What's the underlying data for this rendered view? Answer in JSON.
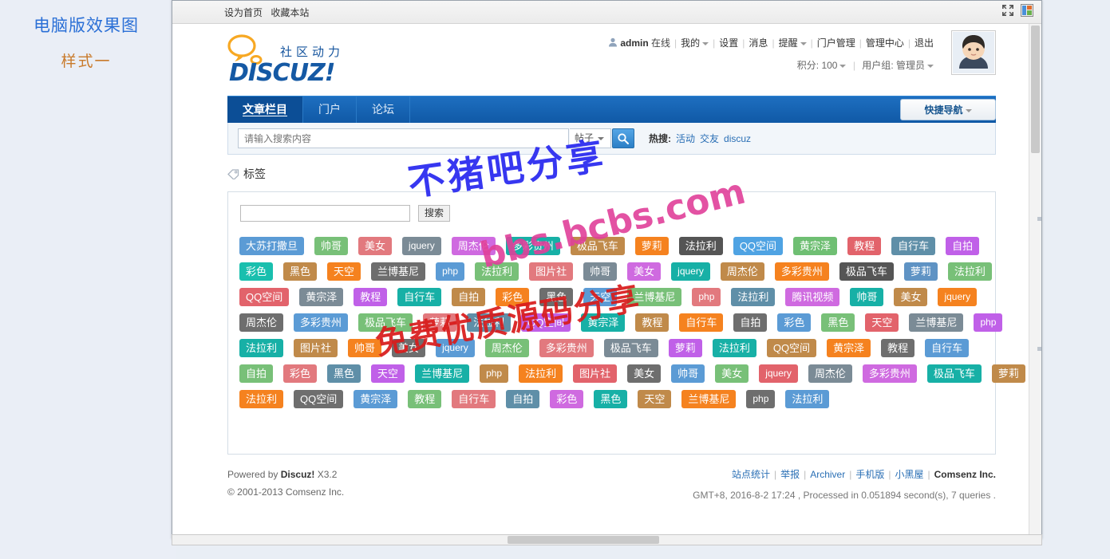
{
  "caption": {
    "line1": "电脑版效果图",
    "line2": "样式一"
  },
  "browser": {
    "topbar_links": [
      "设为首页",
      "收藏本站"
    ],
    "icons": [
      "expand-icon",
      "theme-icon"
    ]
  },
  "logo": {
    "slogan": "社区动力",
    "wordmark": "DISCUZ!"
  },
  "user": {
    "name": "admin",
    "status": "在线",
    "links": [
      "我的",
      "设置",
      "消息",
      "提醒",
      "门户管理",
      "管理中心",
      "退出"
    ],
    "credit_label": "积分",
    "credit_value": "100",
    "group_label": "用户组",
    "group_value": "管理员"
  },
  "nav": {
    "tabs": [
      {
        "label": "文章栏目",
        "active": true
      },
      {
        "label": "门户",
        "active": false
      },
      {
        "label": "论坛",
        "active": false
      }
    ],
    "quick_nav": "快捷导航"
  },
  "search": {
    "placeholder": "请输入搜索内容",
    "value": "",
    "type": "帖子",
    "button_icon": "search-icon",
    "hot_label": "热搜:",
    "hot_items": [
      "活动",
      "交友",
      "discuz"
    ]
  },
  "tag_section": {
    "title": "标签",
    "icon": "tag-icon",
    "filter_value": "",
    "search_button": "搜索",
    "rows": [
      [
        {
          "text": "大苏打撒旦",
          "color": "#5b9bd5"
        },
        {
          "text": "帅哥",
          "color": "#78c078"
        },
        {
          "text": "美女",
          "color": "#e2797e"
        },
        {
          "text": "jquery",
          "color": "#7b8b96"
        },
        {
          "text": "周杰伦",
          "color": "#cf6ae0"
        },
        {
          "text": "多彩贵州",
          "color": "#17b0a6"
        },
        {
          "text": "极品飞车",
          "color": "#c08a4a"
        },
        {
          "text": "萝莉",
          "color": "#f5821f"
        },
        {
          "text": "法拉利",
          "color": "#555555"
        },
        {
          "text": "QQ空间",
          "color": "#4fa3e3"
        },
        {
          "text": "黄宗泽",
          "color": "#6fbf73"
        },
        {
          "text": "教程",
          "color": "#e2636b"
        },
        {
          "text": "自行车",
          "color": "#5f8fa8"
        },
        {
          "text": "自拍",
          "color": "#c060e8"
        }
      ],
      [
        {
          "text": "彩色",
          "color": "#19bfae"
        },
        {
          "text": "黑色",
          "color": "#c08a4a"
        },
        {
          "text": "天空",
          "color": "#f5821f"
        },
        {
          "text": "兰博基尼",
          "color": "#6e6e6e"
        },
        {
          "text": "php",
          "color": "#5b9bd5"
        },
        {
          "text": "法拉利",
          "color": "#78c078"
        },
        {
          "text": "图片社",
          "color": "#e2797e"
        },
        {
          "text": "帅哥",
          "color": "#7b8b96"
        },
        {
          "text": "美女",
          "color": "#cf6ae0"
        },
        {
          "text": "jquery",
          "color": "#17b0a6"
        },
        {
          "text": "周杰伦",
          "color": "#c08a4a"
        },
        {
          "text": "多彩贵州",
          "color": "#f5821f"
        },
        {
          "text": "极品飞车",
          "color": "#555555"
        },
        {
          "text": "萝莉",
          "color": "#5f93c4"
        },
        {
          "text": "法拉利",
          "color": "#78c078"
        }
      ],
      [
        {
          "text": "QQ空间",
          "color": "#e2636b"
        },
        {
          "text": "黄宗泽",
          "color": "#7b8b96"
        },
        {
          "text": "教程",
          "color": "#c060e8"
        },
        {
          "text": "自行车",
          "color": "#17b0a6"
        },
        {
          "text": "自拍",
          "color": "#c08a4a"
        },
        {
          "text": "彩色",
          "color": "#f5821f"
        },
        {
          "text": "黑色",
          "color": "#6e6e6e"
        },
        {
          "text": "天空",
          "color": "#5b9bd5"
        },
        {
          "text": "兰博基尼",
          "color": "#78c078"
        },
        {
          "text": "php",
          "color": "#e2797e"
        },
        {
          "text": "法拉利",
          "color": "#5f8fa8"
        },
        {
          "text": "腾讯视频",
          "color": "#cf6ae0"
        },
        {
          "text": "帅哥",
          "color": "#17b0a6"
        },
        {
          "text": "美女",
          "color": "#c08a4a"
        },
        {
          "text": "jquery",
          "color": "#f5821f"
        }
      ],
      [
        {
          "text": "周杰伦",
          "color": "#6e6e6e"
        },
        {
          "text": "多彩贵州",
          "color": "#5b9bd5"
        },
        {
          "text": "极品飞车",
          "color": "#78c078"
        },
        {
          "text": "萝莉",
          "color": "#e2797e"
        },
        {
          "text": "法拉利",
          "color": "#5f8fa8"
        },
        {
          "text": "QQ空间",
          "color": "#c060e8"
        },
        {
          "text": "黄宗泽",
          "color": "#17b0a6"
        },
        {
          "text": "教程",
          "color": "#c08a4a"
        },
        {
          "text": "自行车",
          "color": "#f5821f"
        },
        {
          "text": "自拍",
          "color": "#6e6e6e"
        },
        {
          "text": "彩色",
          "color": "#5b9bd5"
        },
        {
          "text": "黑色",
          "color": "#78c078"
        },
        {
          "text": "天空",
          "color": "#e2636b"
        },
        {
          "text": "兰博基尼",
          "color": "#7b8b96"
        },
        {
          "text": "php",
          "color": "#c060e8"
        }
      ],
      [
        {
          "text": "法拉利",
          "color": "#17b0a6"
        },
        {
          "text": "图片社",
          "color": "#c08a4a"
        },
        {
          "text": "帅哥",
          "color": "#f5821f"
        },
        {
          "text": "美女",
          "color": "#6e6e6e"
        },
        {
          "text": "jquery",
          "color": "#5b9bd5"
        },
        {
          "text": "周杰伦",
          "color": "#78c078"
        },
        {
          "text": "多彩贵州",
          "color": "#e2797e"
        },
        {
          "text": "极品飞车",
          "color": "#7b8b96"
        },
        {
          "text": "萝莉",
          "color": "#c060e8"
        },
        {
          "text": "法拉利",
          "color": "#17b0a6"
        },
        {
          "text": "QQ空间",
          "color": "#c08a4a"
        },
        {
          "text": "黄宗泽",
          "color": "#f5821f"
        },
        {
          "text": "教程",
          "color": "#6e6e6e"
        },
        {
          "text": "自行车",
          "color": "#5b9bd5"
        }
      ],
      [
        {
          "text": "自拍",
          "color": "#78c078"
        },
        {
          "text": "彩色",
          "color": "#e2797e"
        },
        {
          "text": "黑色",
          "color": "#5f8fa8"
        },
        {
          "text": "天空",
          "color": "#c060e8"
        },
        {
          "text": "兰博基尼",
          "color": "#17b0a6"
        },
        {
          "text": "php",
          "color": "#c08a4a"
        },
        {
          "text": "法拉利",
          "color": "#f5821f"
        },
        {
          "text": "图片社",
          "color": "#e2636b"
        },
        {
          "text": "美女",
          "color": "#6e6e6e"
        },
        {
          "text": "帅哥",
          "color": "#5b9bd5"
        },
        {
          "text": "美女",
          "color": "#78c078"
        },
        {
          "text": "jquery",
          "color": "#e2636b"
        },
        {
          "text": "周杰伦",
          "color": "#7b8b96"
        },
        {
          "text": "多彩贵州",
          "color": "#cf6ae0"
        },
        {
          "text": "极品飞车",
          "color": "#17b0a6"
        },
        {
          "text": "萝莉",
          "color": "#c08a4a"
        }
      ],
      [
        {
          "text": "法拉利",
          "color": "#f5821f"
        },
        {
          "text": "QQ空间",
          "color": "#6e6e6e"
        },
        {
          "text": "黄宗泽",
          "color": "#5b9bd5"
        },
        {
          "text": "教程",
          "color": "#78c078"
        },
        {
          "text": "自行车",
          "color": "#e2797e"
        },
        {
          "text": "自拍",
          "color": "#5f8fa8"
        },
        {
          "text": "彩色",
          "color": "#cf6ae0"
        },
        {
          "text": "黑色",
          "color": "#17b0a6"
        },
        {
          "text": "天空",
          "color": "#c08a4a"
        },
        {
          "text": "兰博基尼",
          "color": "#f5821f"
        },
        {
          "text": "php",
          "color": "#6e6e6e"
        },
        {
          "text": "法拉利",
          "color": "#5b9bd5"
        }
      ]
    ]
  },
  "footer": {
    "powered_prefix": "Powered by",
    "powered_brand": "Discuz!",
    "powered_version": "X3.2",
    "copyright": "© 2001-2013 Comsenz Inc.",
    "links": [
      "站点统计",
      "举报",
      "Archiver",
      "手机版",
      "小黑屋"
    ],
    "company": "Comsenz Inc.",
    "server_time": "GMT+8, 2016-8-2 17:24 , Processed in 0.051894 second(s), 7 queries ."
  },
  "watermarks": {
    "wm1": "不猪吧分享",
    "wm2": "bbs.bcbs.com",
    "wm3": "免费优质源码分享"
  }
}
